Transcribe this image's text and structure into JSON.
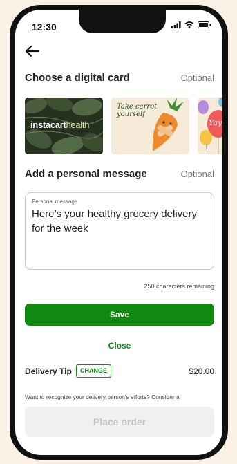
{
  "status_bar": {
    "time": "12:30"
  },
  "digital_card": {
    "title": "Choose a digital card",
    "optional_label": "Optional",
    "cards": [
      {
        "brand": "instacart",
        "brand_accent": "health"
      },
      {
        "text": "Take carrot yourself"
      },
      {
        "text": "Yay"
      }
    ]
  },
  "personal_message": {
    "title": "Add a personal message",
    "optional_label": "Optional",
    "field_label": "Personal message",
    "value": "Here’s your healthy grocery delivery for the week",
    "remaining": "250 characters remaining"
  },
  "actions": {
    "save_label": "Save",
    "close_label": "Close"
  },
  "delivery_tip": {
    "label": "Delivery Tip",
    "change_label": "CHANGE",
    "amount": "$20.00",
    "note": "Want to recognize your delivery person's efforts? Consider a"
  },
  "place_order": {
    "label": "Place order"
  },
  "colors": {
    "brand_green": "#108910",
    "page_background": "#faf1e4",
    "disabled_button": "#f0f0f0"
  }
}
